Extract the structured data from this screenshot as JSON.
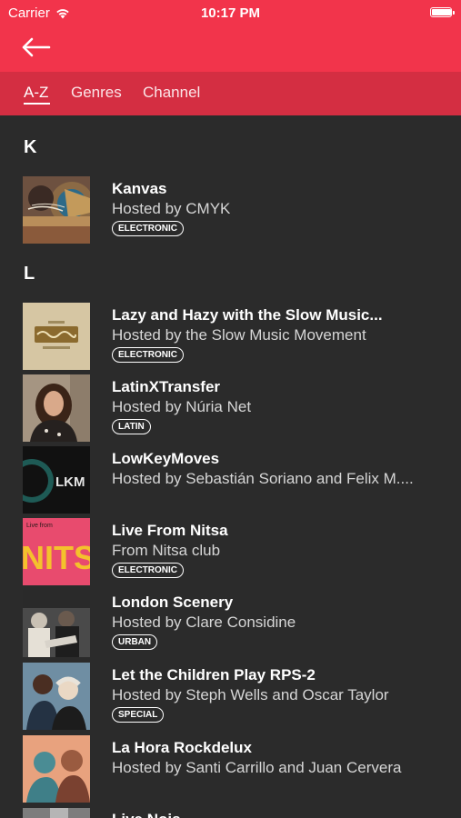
{
  "status_bar": {
    "carrier": "Carrier",
    "time": "10:17 PM",
    "battery_level": 0.95
  },
  "nav": {
    "back_icon": "back-arrow-icon"
  },
  "tabs": [
    {
      "label": "A-Z",
      "active": true
    },
    {
      "label": "Genres",
      "active": false
    },
    {
      "label": "Channel",
      "active": false
    }
  ],
  "sections": [
    {
      "letter": "K",
      "items": [
        {
          "title": "Kanvas",
          "host": "Hosted by CMYK",
          "tag": "ELECTRONIC"
        }
      ]
    },
    {
      "letter": "L",
      "items": [
        {
          "title": "Lazy and Hazy with the Slow Music...",
          "host": "Hosted by the Slow Music Movement",
          "tag": "ELECTRONIC"
        },
        {
          "title": "LatinXTransfer",
          "host": "Hosted by Núria Net",
          "tag": "LATIN"
        },
        {
          "title": "LowKeyMoves",
          "host": "Hosted by Sebastián Soriano and Felix M....",
          "tag": ""
        },
        {
          "title": "Live From Nitsa",
          "host": "From Nitsa club",
          "tag": "ELECTRONIC"
        },
        {
          "title": "London Scenery",
          "host": "Hosted by Clare Considine",
          "tag": "URBAN"
        },
        {
          "title": "Let the Children Play RPS-2",
          "host": "Hosted by Steph Wells and Oscar Taylor",
          "tag": "SPECIAL"
        },
        {
          "title": "La Hora Rockdelux",
          "host": "Hosted by Santi Carrillo and Juan Cervera",
          "tag": ""
        },
        {
          "title": "Live Nois...",
          "host": "",
          "tag": ""
        }
      ]
    }
  ],
  "thumb_text": {
    "lkm": "LKM",
    "nitsa_caption": "Live from",
    "nitsa": "NITSA"
  },
  "colors": {
    "accent": "#f2344b",
    "accent_dark": "#d42e42",
    "background": "#2b2b2b"
  }
}
